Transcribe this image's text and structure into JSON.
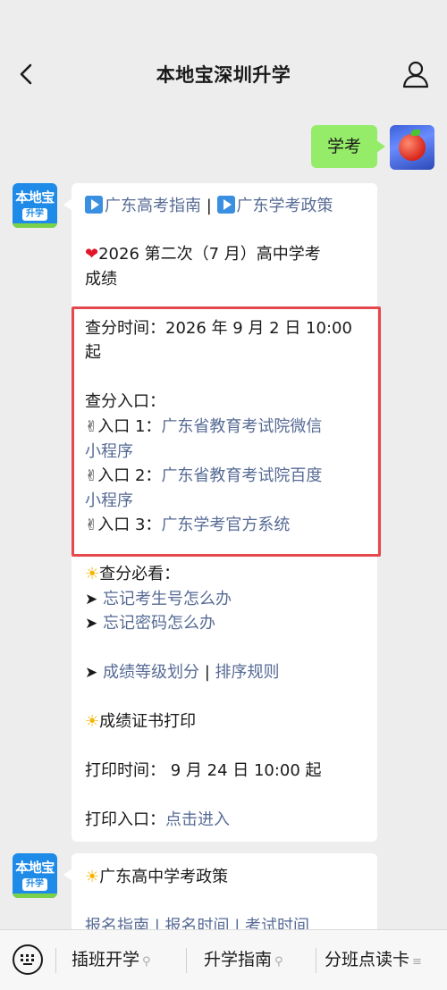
{
  "header": {
    "title": "本地宝深圳升学"
  },
  "outgoing_message": {
    "text": "学考"
  },
  "bot_avatar": {
    "top_text": "本地宝",
    "bottom_text": "升学"
  },
  "card1": {
    "link_guide": "广东高考指南",
    "divider": "|",
    "link_policy": "广东学考政策",
    "headline_1": "2026 第二次（7 月）高中学考",
    "headline_2": "成绩",
    "query_time_1": "查分时间：2026 年 9 月 2 日 10:00",
    "query_time_2": "起",
    "entrance_title": "查分入口：",
    "entry1_label": "入口 1：",
    "entry1_link_1": "广东省教育考试院微信",
    "entry1_link_2": "小程序",
    "entry2_label": "入口 2：",
    "entry2_link_1": "广东省教育考试院百度",
    "entry2_link_2": "小程序",
    "entry3_label": "入口 3：",
    "entry3_link": "广东学考官方系统",
    "must_read": "查分必看：",
    "forgot_exam_no": "忘记考生号怎么办",
    "forgot_password": "忘记密码怎么办",
    "grade_levels": "成绩等级划分",
    "ranking_rules": "排序规则",
    "certificate": "成绩证书打印",
    "print_time": "打印时间： 9 月 24 日 10:00 起",
    "print_entry": "打印入口：",
    "click_enter": "点击进入"
  },
  "card2": {
    "title": "广东高中学考政策",
    "partial_line": "报名指南 | 报名时间 | 考试时间"
  },
  "bottom_menu": {
    "tab1": "插班开学",
    "tab2": "升学指南",
    "tab3": "分班点读卡"
  }
}
